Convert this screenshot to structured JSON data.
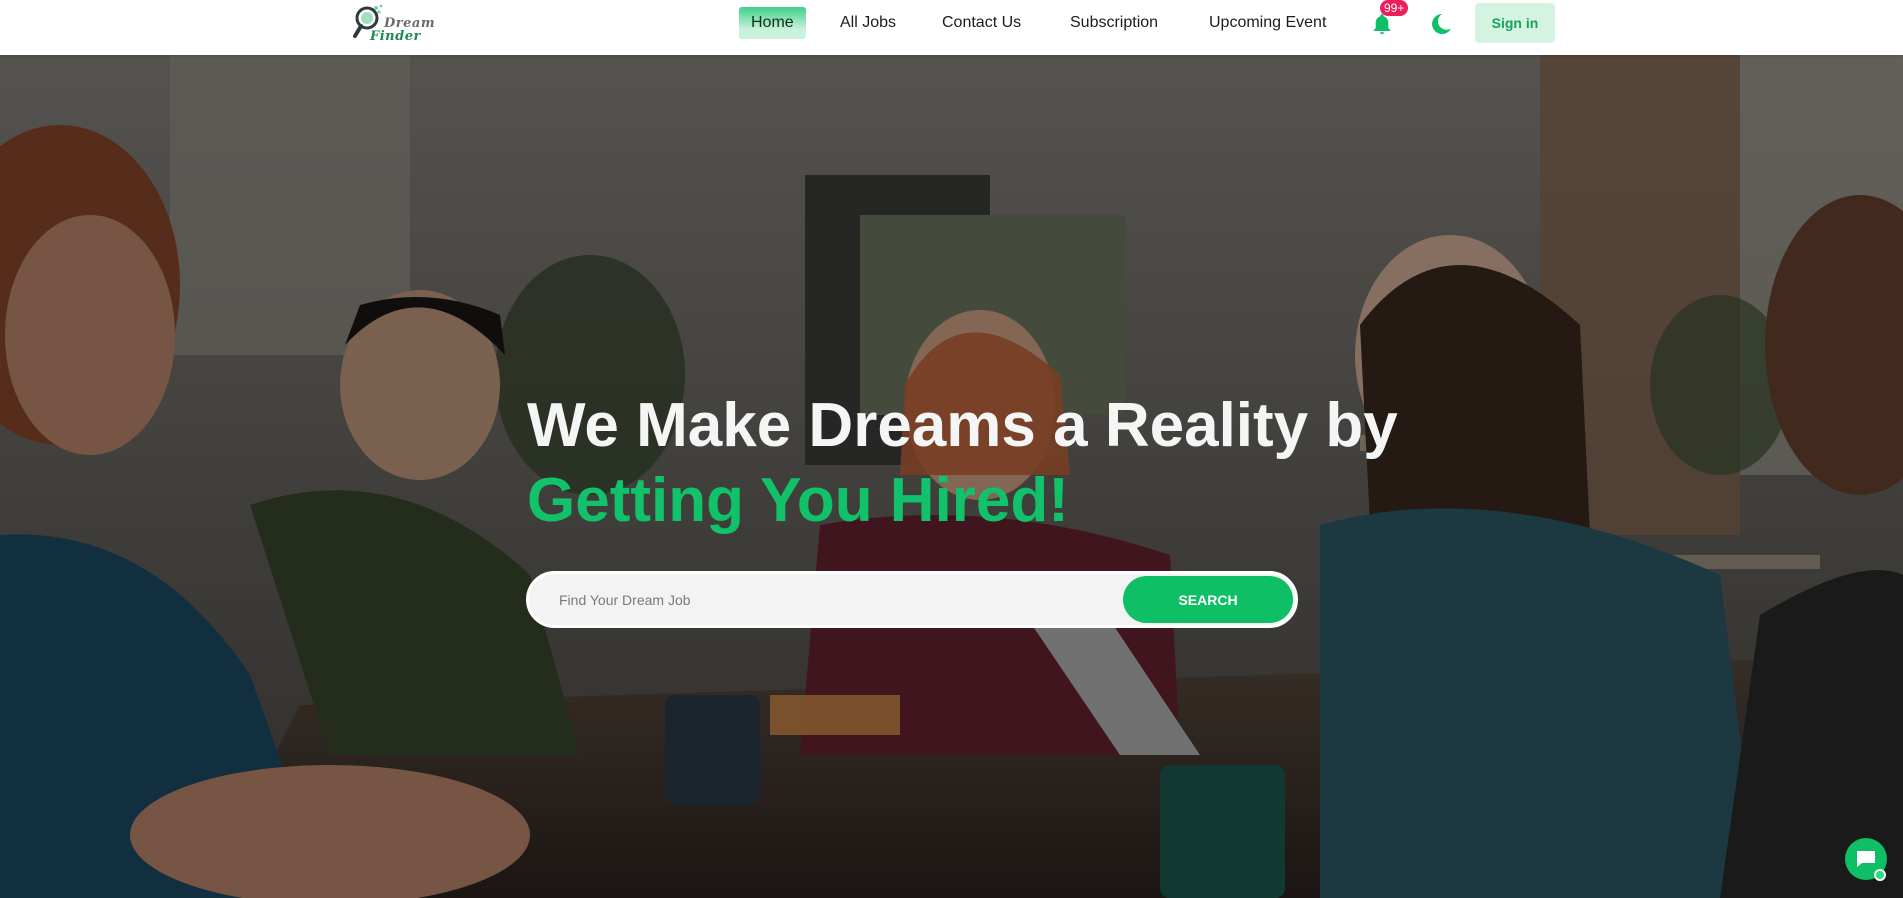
{
  "brand": {
    "line1": "Dream",
    "line2": "Finder",
    "accent_color": "#12c26a"
  },
  "nav": {
    "items": [
      {
        "label": "Home",
        "active": true
      },
      {
        "label": "All Jobs",
        "active": false
      },
      {
        "label": "Contact Us",
        "active": false
      },
      {
        "label": "Subscription",
        "active": false
      },
      {
        "label": "Upcoming Event",
        "active": false
      }
    ],
    "notifications_badge": "99+",
    "notification_icon": "bell-icon",
    "theme_icon": "moon-icon",
    "signin_label": "Sign in"
  },
  "hero": {
    "headline_line1": "We Make Dreams a Reality by",
    "headline_line2": "Getting You Hired!",
    "search": {
      "placeholder": "Find Your Dream Job",
      "value": "",
      "button_label": "SEARCH"
    }
  },
  "chat": {
    "icon": "chat-bubble-icon",
    "status": "online"
  }
}
